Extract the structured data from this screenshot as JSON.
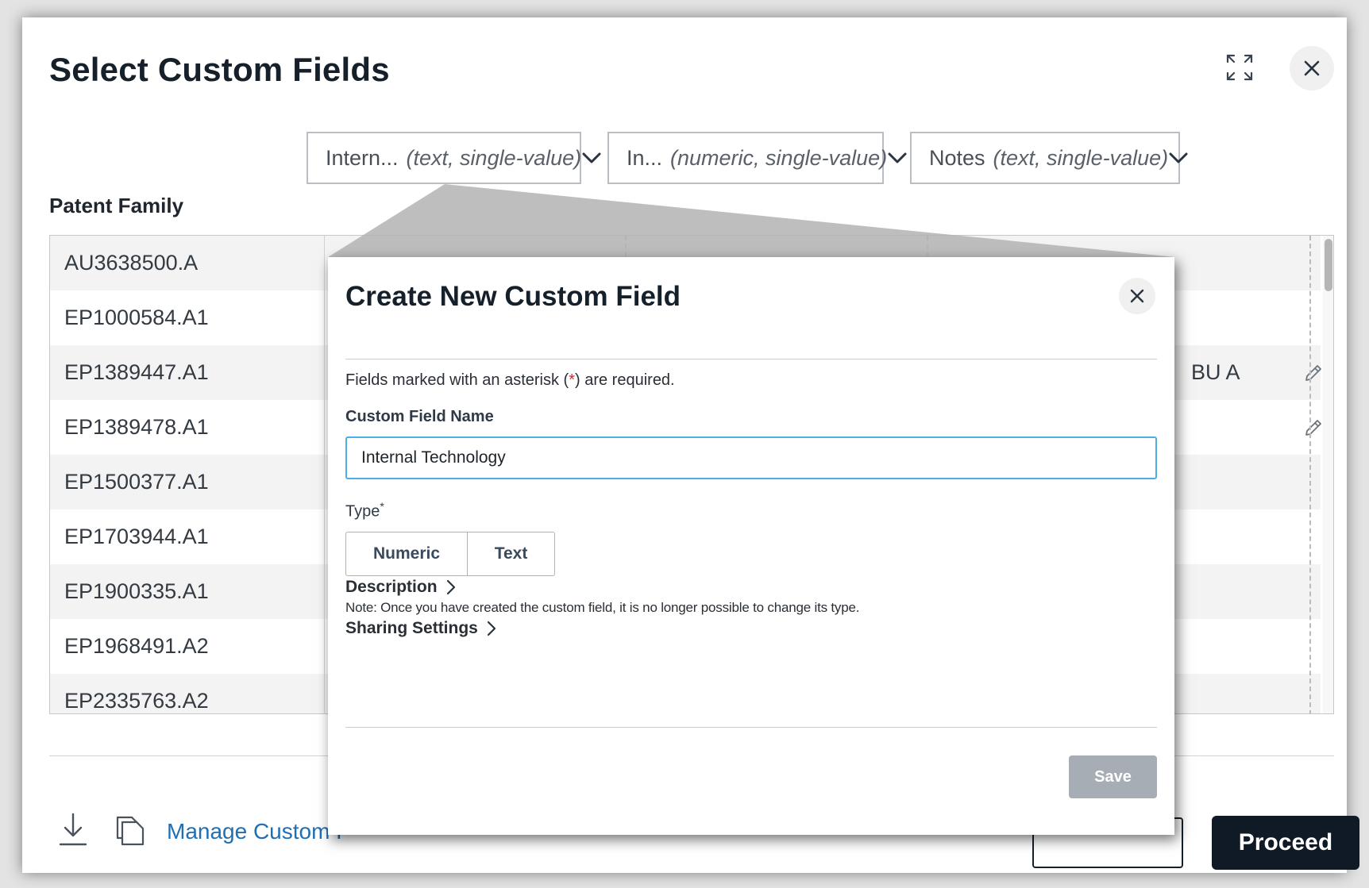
{
  "dialog": {
    "title": "Select Custom Fields",
    "expand_icon": "expand-arrows-icon",
    "close_icon": "close-icon"
  },
  "column_selectors": [
    {
      "name": "Intern...",
      "type": "(text, single-value)"
    },
    {
      "name": "In...",
      "type": "(numeric, single-value)"
    },
    {
      "name": "Notes",
      "type": "(text, single-value)"
    }
  ],
  "grid": {
    "header": "Patent Family",
    "rows": [
      "AU3638500.A",
      "EP1000584.A1",
      "EP1389447.A1",
      "EP1389478.A1",
      "EP1500377.A1",
      "EP1703944.A1",
      "EP1900335.A1",
      "EP1968491.A2",
      "EP2335763.A2"
    ],
    "partial_cell_text": "BU A",
    "edit_icon": "pencil-icon"
  },
  "footer": {
    "download_icon": "download-icon",
    "copy_icon": "copy-icon",
    "manage_link": "Manage Custom F",
    "proceed_label": "Proceed"
  },
  "modal": {
    "title": "Create New Custom Field",
    "required_note_prefix": "Fields marked with an asterisk (",
    "required_note_asterisk": "*",
    "required_note_suffix": ") are required.",
    "name_label": "Custom Field Name",
    "name_value": "Internal Technology",
    "type_label": "Type",
    "type_required": "*",
    "type_options": [
      "Numeric",
      "Text"
    ],
    "type_note": "Note: Once you have created the custom field, it is no longer possible to change its type.",
    "description_label": "Description",
    "sharing_label": "Sharing Settings",
    "save_label": "Save"
  },
  "colors": {
    "primary_dark": "#0f1a26",
    "link_blue": "#1f6fb2",
    "input_focus": "#4ab0e3",
    "save_disabled": "#a6adb4",
    "asterisk_red": "#d0252f"
  }
}
